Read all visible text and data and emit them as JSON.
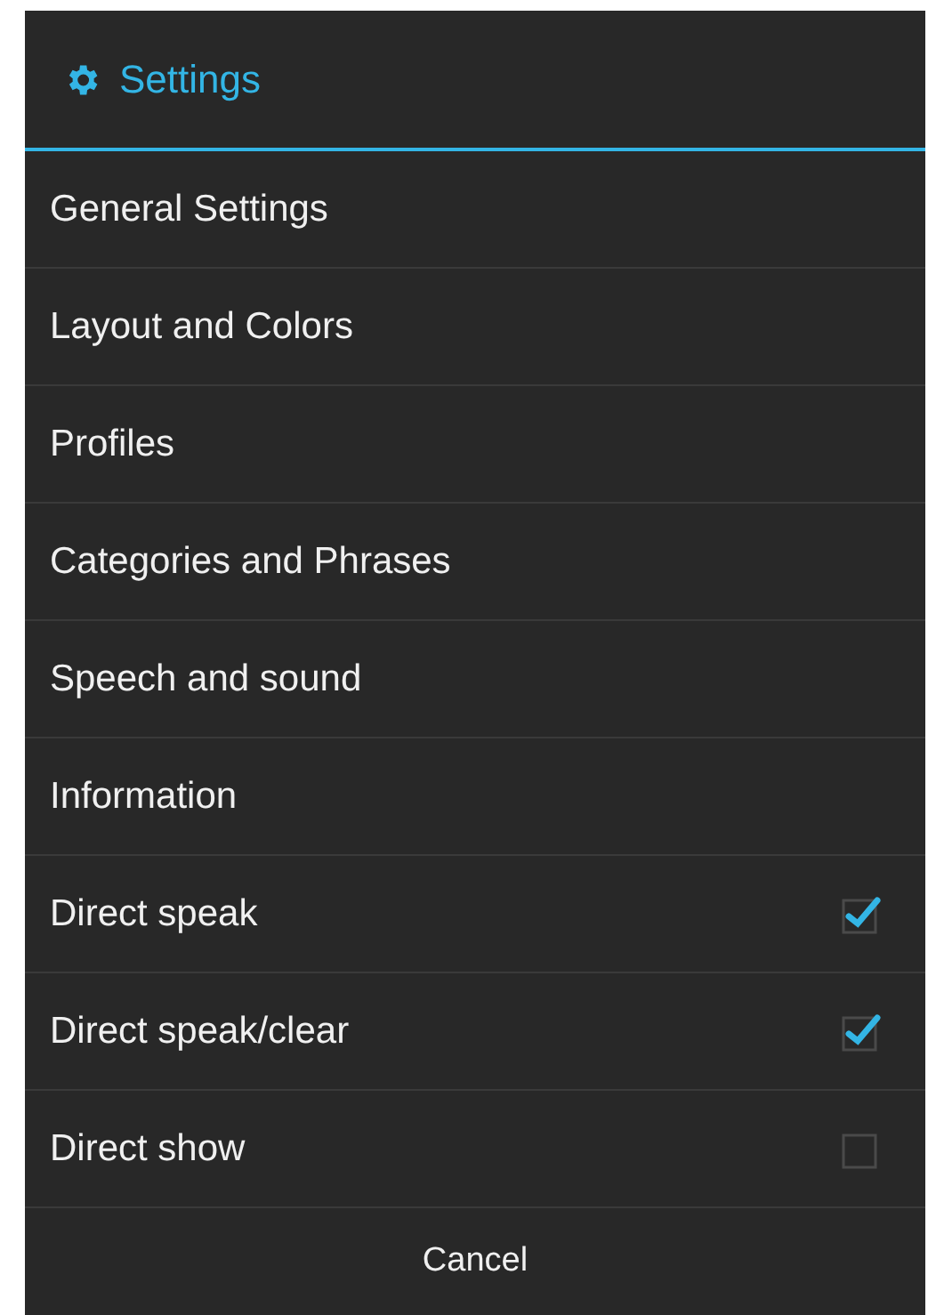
{
  "dialog": {
    "title": "Settings"
  },
  "items": [
    {
      "kind": "link",
      "label": "General Settings"
    },
    {
      "kind": "link",
      "label": "Layout and Colors"
    },
    {
      "kind": "link",
      "label": "Profiles"
    },
    {
      "kind": "link",
      "label": "Categories and Phrases"
    },
    {
      "kind": "link",
      "label": "Speech and sound"
    },
    {
      "kind": "link",
      "label": "Information"
    },
    {
      "kind": "checkbox",
      "label": "Direct speak",
      "checked": true
    },
    {
      "kind": "checkbox",
      "label": "Direct speak/clear",
      "checked": true
    },
    {
      "kind": "checkbox",
      "label": "Direct show",
      "checked": false
    }
  ],
  "buttons": [
    "Cancel"
  ]
}
